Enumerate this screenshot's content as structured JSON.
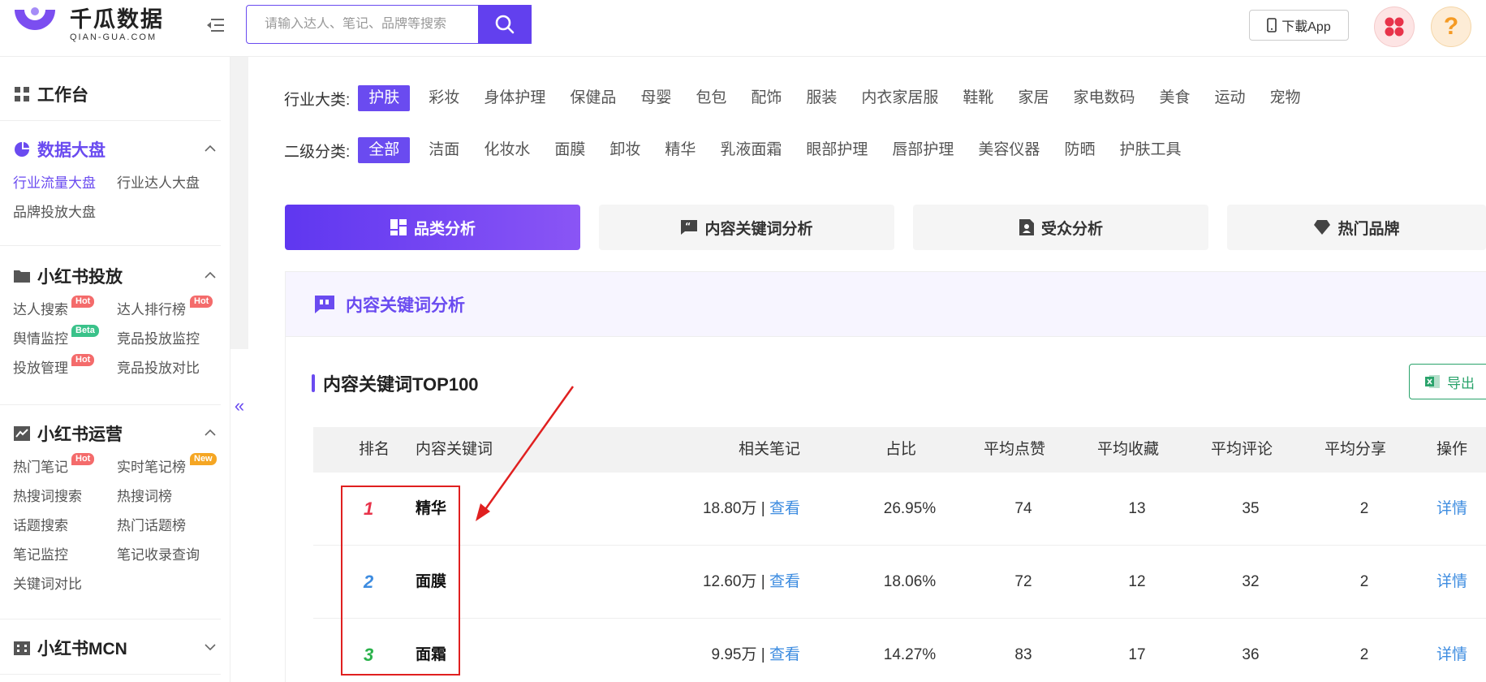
{
  "header": {
    "logo_cn": "千瓜数据",
    "logo_en": "QIAN-GUA.COM",
    "search_placeholder": "请输入达人、笔记、品牌等搜索",
    "download_label": "下載App",
    "help_glyph": "?"
  },
  "sidebar": {
    "workbench": "工作台",
    "sections": [
      {
        "title": "数据大盘",
        "items": [
          {
            "label": "行业流量大盘",
            "badge": ""
          },
          {
            "label": "行业达人大盘",
            "badge": ""
          },
          {
            "label": "品牌投放大盘",
            "badge": ""
          }
        ]
      },
      {
        "title": "小红书投放",
        "items": [
          {
            "label": "达人搜索",
            "badge": "Hot"
          },
          {
            "label": "达人排行榜",
            "badge": "Hot"
          },
          {
            "label": "舆情监控",
            "badge": "Beta"
          },
          {
            "label": "竞品投放监控",
            "badge": ""
          },
          {
            "label": "投放管理",
            "badge": "Hot"
          },
          {
            "label": "竞品投放对比",
            "badge": ""
          }
        ]
      },
      {
        "title": "小红书运营",
        "items": [
          {
            "label": "热门笔记",
            "badge": "Hot"
          },
          {
            "label": "实时笔记榜",
            "badge": "New"
          },
          {
            "label": "热搜词搜索",
            "badge": ""
          },
          {
            "label": "热搜词榜",
            "badge": ""
          },
          {
            "label": "话题搜索",
            "badge": ""
          },
          {
            "label": "热门话题榜",
            "badge": ""
          },
          {
            "label": "笔记监控",
            "badge": ""
          },
          {
            "label": "笔记收录查询",
            "badge": ""
          },
          {
            "label": "关键词对比",
            "badge": ""
          }
        ]
      },
      {
        "title": "小红书MCN",
        "items": []
      }
    ],
    "collapse_glyph": "«"
  },
  "filters": {
    "industry_label": "行业大类:",
    "industry_options": [
      "护肤",
      "彩妆",
      "身体护理",
      "保健品",
      "母婴",
      "包包",
      "配饰",
      "服装",
      "内衣家居服",
      "鞋靴",
      "家居",
      "家电数码",
      "美食",
      "运动",
      "宠物"
    ],
    "sub_label": "二级分类:",
    "sub_options": [
      "全部",
      "洁面",
      "化妆水",
      "面膜",
      "卸妆",
      "精华",
      "乳液面霜",
      "眼部护理",
      "唇部护理",
      "美容仪器",
      "防晒",
      "护肤工具"
    ]
  },
  "tabs": [
    "品类分析",
    "内容关键词分析",
    "受众分析",
    "热门品牌"
  ],
  "panel": {
    "title": "内容关键词分析",
    "subtitle": "内容关键词TOP100",
    "export_label": "导出"
  },
  "table": {
    "headers": [
      "排名",
      "内容关键词",
      "相关笔记",
      "占比",
      "平均点赞",
      "平均收藏",
      "平均评论",
      "平均分享",
      "操作"
    ],
    "view_label": "查看",
    "detail_label": "详情",
    "rows": [
      {
        "rank": "1",
        "keyword": "精华",
        "notes": "18.80万",
        "sep": " | ",
        "ratio": "26.95%",
        "likes": "74",
        "collects": "13",
        "comments": "35",
        "shares": "2"
      },
      {
        "rank": "2",
        "keyword": "面膜",
        "notes": "12.60万",
        "sep": " | ",
        "ratio": "18.06%",
        "likes": "72",
        "collects": "12",
        "comments": "32",
        "shares": "2"
      },
      {
        "rank": "3",
        "keyword": "面霜",
        "notes": "9.95万",
        "sep": " | ",
        "ratio": "14.27%",
        "likes": "83",
        "collects": "17",
        "comments": "36",
        "shares": "2"
      }
    ]
  },
  "colors": {
    "accent": "#6a4bf0",
    "rank1": "#e8334a",
    "rank2": "#3d8ce0",
    "rank3": "#2bb24c",
    "annotation": "#e02020"
  }
}
